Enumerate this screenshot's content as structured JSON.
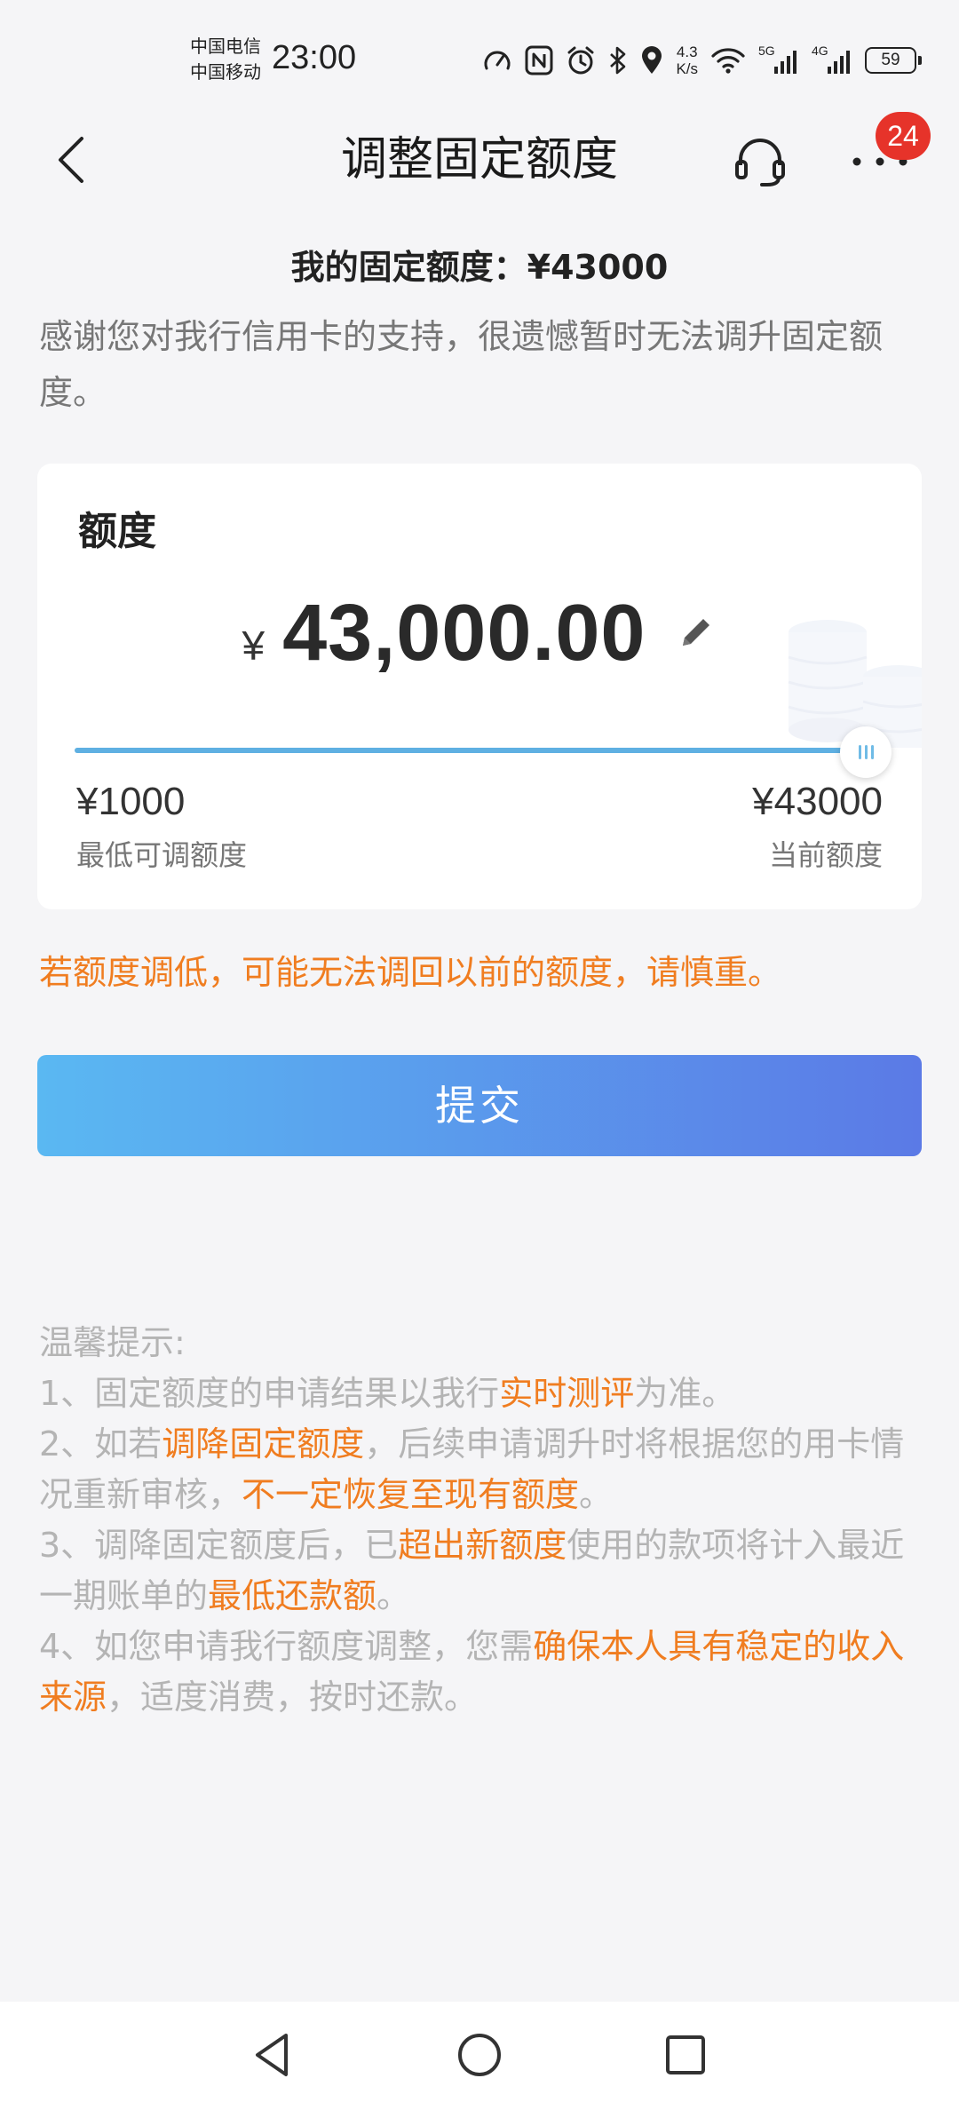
{
  "status_bar": {
    "carrier_1": "中国电信",
    "carrier_2": "中国移动",
    "time": "23:00",
    "net_speed_value": "4.3",
    "net_speed_unit": "K/s",
    "signal_1_label": "5G",
    "signal_2_label": "4G",
    "battery": "59",
    "icons": [
      "speed-icon",
      "nfc-icon",
      "alarm-icon",
      "bluetooth-icon",
      "location-icon",
      "wifi-icon",
      "signal-icon",
      "battery-icon"
    ]
  },
  "header": {
    "title": "调整固定额度",
    "notification_count": "24",
    "icons": [
      "back-icon",
      "headset-icon",
      "more-icon"
    ]
  },
  "summary": {
    "fixed_quota": "我的固定额度：¥43000",
    "notice": "感谢您对我行信用卡的支持，很遗憾暂时无法调升固定额度。"
  },
  "quota_card": {
    "label": "额度",
    "currency": "¥",
    "amount": "43,000.00",
    "min_value": "¥1000",
    "min_label": "最低可调额度",
    "max_value": "¥43000",
    "max_label": "当前额度",
    "slider_fraction": 1.0
  },
  "warning": "若额度调低，可能无法调回以前的额度，请慎重。",
  "submit_label": "提交",
  "tips": {
    "title": "温馨提示:",
    "items": [
      [
        {
          "text": "1、固定额度的申请结果以我行",
          "hl": false
        },
        {
          "text": "实时测评",
          "hl": true
        },
        {
          "text": "为准。",
          "hl": false
        }
      ],
      [
        {
          "text": "2、如若",
          "hl": false
        },
        {
          "text": "调降固定额度",
          "hl": true
        },
        {
          "text": "，后续申请调升时将根据您的用卡情况重新审核，",
          "hl": false
        },
        {
          "text": "不一定恢复至现有额度",
          "hl": true
        },
        {
          "text": "。",
          "hl": false
        }
      ],
      [
        {
          "text": "3、调降固定额度后，已",
          "hl": false
        },
        {
          "text": "超出新额度",
          "hl": true
        },
        {
          "text": "使用的款项将计入最近一期账单的",
          "hl": false
        },
        {
          "text": "最低还款额",
          "hl": true
        },
        {
          "text": "。",
          "hl": false
        }
      ],
      [
        {
          "text": "4、如您申请我行额度调整，您需",
          "hl": false
        },
        {
          "text": "确保本人具有稳定的收入来源",
          "hl": true
        },
        {
          "text": "，适度消费，按时还款。",
          "hl": false
        }
      ]
    ]
  },
  "colors": {
    "accent_orange": "#f07d20",
    "button_gradient_start": "#5ab8f2",
    "button_gradient_end": "#5b7ae6",
    "slider_fill": "#5fb0e2",
    "badge_red": "#e6332a"
  },
  "nav_bar": {
    "icons": [
      "nav-back-icon",
      "nav-home-icon",
      "nav-recents-icon"
    ]
  }
}
